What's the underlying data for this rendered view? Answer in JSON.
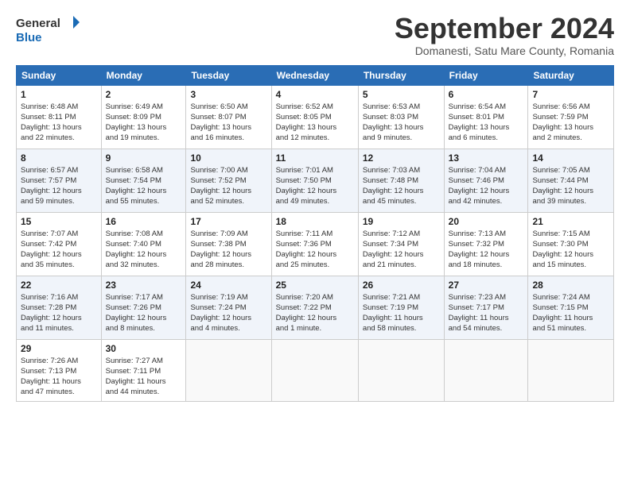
{
  "header": {
    "logo_line1": "General",
    "logo_line2": "Blue",
    "month_title": "September 2024",
    "subtitle": "Domanesti, Satu Mare County, Romania"
  },
  "days_of_week": [
    "Sunday",
    "Monday",
    "Tuesday",
    "Wednesday",
    "Thursday",
    "Friday",
    "Saturday"
  ],
  "weeks": [
    [
      {
        "day": "1",
        "info": "Sunrise: 6:48 AM\nSunset: 8:11 PM\nDaylight: 13 hours\nand 22 minutes."
      },
      {
        "day": "2",
        "info": "Sunrise: 6:49 AM\nSunset: 8:09 PM\nDaylight: 13 hours\nand 19 minutes."
      },
      {
        "day": "3",
        "info": "Sunrise: 6:50 AM\nSunset: 8:07 PM\nDaylight: 13 hours\nand 16 minutes."
      },
      {
        "day": "4",
        "info": "Sunrise: 6:52 AM\nSunset: 8:05 PM\nDaylight: 13 hours\nand 12 minutes."
      },
      {
        "day": "5",
        "info": "Sunrise: 6:53 AM\nSunset: 8:03 PM\nDaylight: 13 hours\nand 9 minutes."
      },
      {
        "day": "6",
        "info": "Sunrise: 6:54 AM\nSunset: 8:01 PM\nDaylight: 13 hours\nand 6 minutes."
      },
      {
        "day": "7",
        "info": "Sunrise: 6:56 AM\nSunset: 7:59 PM\nDaylight: 13 hours\nand 2 minutes."
      }
    ],
    [
      {
        "day": "8",
        "info": "Sunrise: 6:57 AM\nSunset: 7:57 PM\nDaylight: 12 hours\nand 59 minutes."
      },
      {
        "day": "9",
        "info": "Sunrise: 6:58 AM\nSunset: 7:54 PM\nDaylight: 12 hours\nand 55 minutes."
      },
      {
        "day": "10",
        "info": "Sunrise: 7:00 AM\nSunset: 7:52 PM\nDaylight: 12 hours\nand 52 minutes."
      },
      {
        "day": "11",
        "info": "Sunrise: 7:01 AM\nSunset: 7:50 PM\nDaylight: 12 hours\nand 49 minutes."
      },
      {
        "day": "12",
        "info": "Sunrise: 7:03 AM\nSunset: 7:48 PM\nDaylight: 12 hours\nand 45 minutes."
      },
      {
        "day": "13",
        "info": "Sunrise: 7:04 AM\nSunset: 7:46 PM\nDaylight: 12 hours\nand 42 minutes."
      },
      {
        "day": "14",
        "info": "Sunrise: 7:05 AM\nSunset: 7:44 PM\nDaylight: 12 hours\nand 39 minutes."
      }
    ],
    [
      {
        "day": "15",
        "info": "Sunrise: 7:07 AM\nSunset: 7:42 PM\nDaylight: 12 hours\nand 35 minutes."
      },
      {
        "day": "16",
        "info": "Sunrise: 7:08 AM\nSunset: 7:40 PM\nDaylight: 12 hours\nand 32 minutes."
      },
      {
        "day": "17",
        "info": "Sunrise: 7:09 AM\nSunset: 7:38 PM\nDaylight: 12 hours\nand 28 minutes."
      },
      {
        "day": "18",
        "info": "Sunrise: 7:11 AM\nSunset: 7:36 PM\nDaylight: 12 hours\nand 25 minutes."
      },
      {
        "day": "19",
        "info": "Sunrise: 7:12 AM\nSunset: 7:34 PM\nDaylight: 12 hours\nand 21 minutes."
      },
      {
        "day": "20",
        "info": "Sunrise: 7:13 AM\nSunset: 7:32 PM\nDaylight: 12 hours\nand 18 minutes."
      },
      {
        "day": "21",
        "info": "Sunrise: 7:15 AM\nSunset: 7:30 PM\nDaylight: 12 hours\nand 15 minutes."
      }
    ],
    [
      {
        "day": "22",
        "info": "Sunrise: 7:16 AM\nSunset: 7:28 PM\nDaylight: 12 hours\nand 11 minutes."
      },
      {
        "day": "23",
        "info": "Sunrise: 7:17 AM\nSunset: 7:26 PM\nDaylight: 12 hours\nand 8 minutes."
      },
      {
        "day": "24",
        "info": "Sunrise: 7:19 AM\nSunset: 7:24 PM\nDaylight: 12 hours\nand 4 minutes."
      },
      {
        "day": "25",
        "info": "Sunrise: 7:20 AM\nSunset: 7:22 PM\nDaylight: 12 hours\nand 1 minute."
      },
      {
        "day": "26",
        "info": "Sunrise: 7:21 AM\nSunset: 7:19 PM\nDaylight: 11 hours\nand 58 minutes."
      },
      {
        "day": "27",
        "info": "Sunrise: 7:23 AM\nSunset: 7:17 PM\nDaylight: 11 hours\nand 54 minutes."
      },
      {
        "day": "28",
        "info": "Sunrise: 7:24 AM\nSunset: 7:15 PM\nDaylight: 11 hours\nand 51 minutes."
      }
    ],
    [
      {
        "day": "29",
        "info": "Sunrise: 7:26 AM\nSunset: 7:13 PM\nDaylight: 11 hours\nand 47 minutes."
      },
      {
        "day": "30",
        "info": "Sunrise: 7:27 AM\nSunset: 7:11 PM\nDaylight: 11 hours\nand 44 minutes."
      },
      {
        "day": "",
        "info": ""
      },
      {
        "day": "",
        "info": ""
      },
      {
        "day": "",
        "info": ""
      },
      {
        "day": "",
        "info": ""
      },
      {
        "day": "",
        "info": ""
      }
    ]
  ]
}
